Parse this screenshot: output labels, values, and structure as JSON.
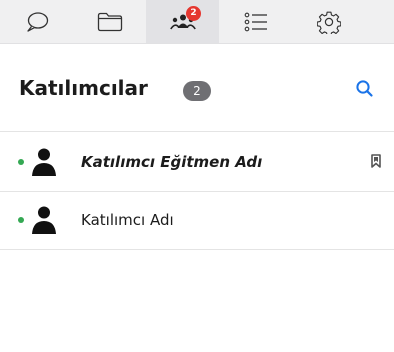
{
  "tabs": [
    {
      "icon": "chat-icon"
    },
    {
      "icon": "folder-icon"
    },
    {
      "icon": "participants-icon",
      "badge": "2"
    },
    {
      "icon": "list-icon"
    },
    {
      "icon": "gear-icon"
    }
  ],
  "header": {
    "title": "Katılımcılar",
    "count": "2",
    "search_icon": "search-icon"
  },
  "participants": [
    {
      "name": "Katılımcı Eğitmen Adı",
      "status": "online",
      "role": "instructor",
      "bookmark": true
    },
    {
      "name": "Katılımcı Adı",
      "status": "online",
      "role": "participant",
      "bookmark": false
    }
  ],
  "colors": {
    "accent": "#1a73e8",
    "badge_red": "#e5362f",
    "online": "#34a853",
    "count_badge": "#6f6f73"
  }
}
